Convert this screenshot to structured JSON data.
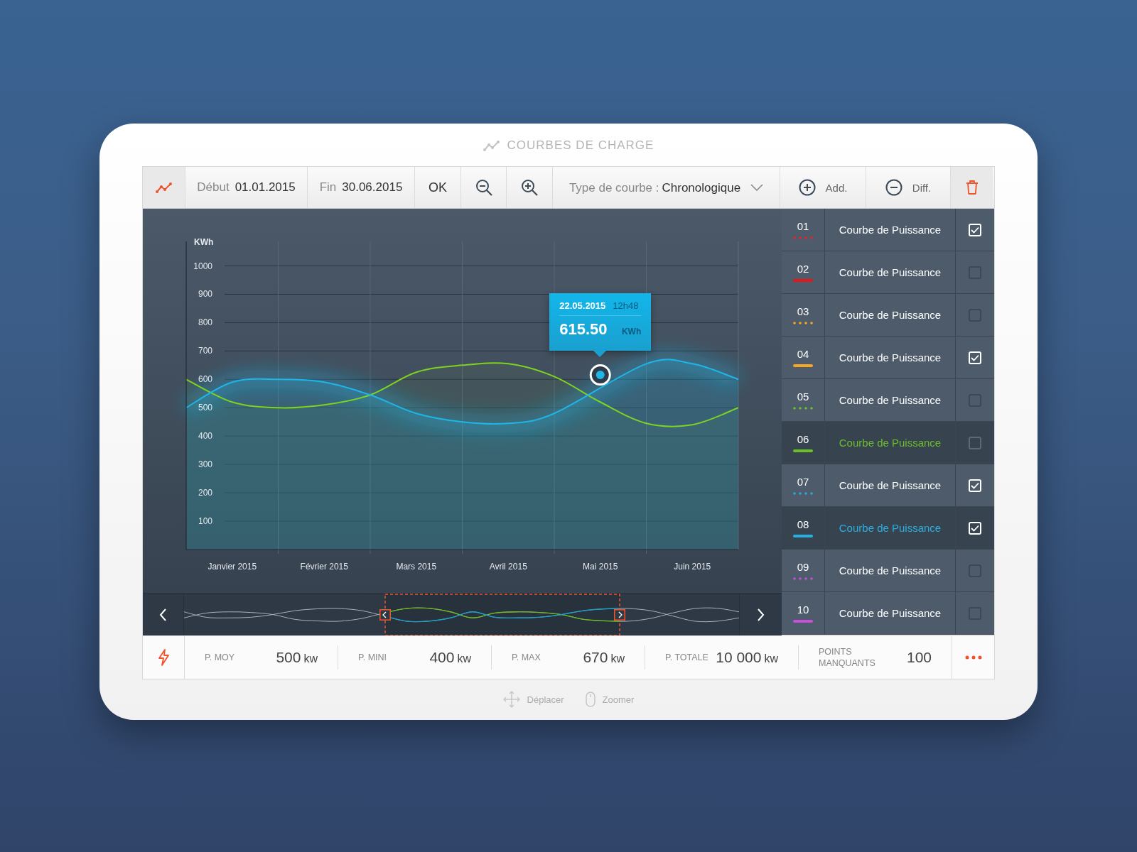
{
  "title": "COURBES DE CHARGE",
  "toolbar": {
    "start": {
      "label": "Début",
      "value": "01.01.2015"
    },
    "end": {
      "label": "Fin",
      "value": "30.06.2015"
    },
    "ok": "OK",
    "curve_type": {
      "label": "Type de courbe :",
      "value": "Chronologique"
    },
    "add": "Add.",
    "diff": "Diff."
  },
  "chart": {
    "tooltip": {
      "date": "22.05.2015",
      "time": "12h48",
      "unit": "KWh"
    },
    "chart_data": {
      "type": "area",
      "ylabel": "KWh",
      "grid": true,
      "categories": [
        null,
        "Janvier 2015",
        null,
        "Février 2015",
        null,
        "Mars 2015",
        null,
        "Avril 2015",
        null,
        "Mai 2015",
        null,
        "Juin 2015",
        null
      ],
      "ylim": [
        0,
        1000
      ],
      "yticks": [
        {
          "value": 100,
          "label": "100"
        },
        {
          "value": 200,
          "label": "200"
        },
        {
          "value": 300,
          "label": "300"
        },
        {
          "value": 400,
          "label": "400"
        },
        {
          "value": 500,
          "label": "500"
        },
        {
          "value": 600,
          "label": "600"
        },
        {
          "value": 700,
          "label": "700"
        },
        {
          "value": 800,
          "label": "800"
        },
        {
          "value": 900,
          "label": "900"
        },
        {
          "value": 1000,
          "label": "1000"
        }
      ],
      "series": [
        {
          "color": "#7ed321",
          "values": [
            600,
            520,
            500,
            510,
            545,
            625,
            650,
            655,
            610,
            520,
            445,
            440,
            500
          ]
        },
        {
          "color": "#1fb5e6",
          "values": [
            500,
            590,
            600,
            590,
            545,
            480,
            450,
            445,
            480,
            null,
            655,
            655,
            600
          ]
        }
      ],
      "annotations": [
        {
          "x": "Mai 2015",
          "y": 615.5,
          "text": "615.50"
        }
      ]
    }
  },
  "legend": [
    {
      "number": "01",
      "kind": "dotted",
      "color": "#e8262a",
      "label": "Courbe de Puissance",
      "checked": true,
      "selected": false
    },
    {
      "number": "02",
      "kind": "solid",
      "color": "#e8141b",
      "label": "Courbe de Puissance",
      "checked": false,
      "selected": false
    },
    {
      "number": "03",
      "kind": "dotted",
      "color": "#f5a623",
      "label": "Courbe de Puissance",
      "checked": false,
      "selected": false
    },
    {
      "number": "04",
      "kind": "solid",
      "color": "#f5a623",
      "label": "Courbe de Puissance",
      "checked": true,
      "selected": false
    },
    {
      "number": "05",
      "kind": "dotted",
      "color": "#6cbf2a",
      "label": "Courbe de Puissance",
      "checked": false,
      "selected": false
    },
    {
      "number": "06",
      "kind": "solid",
      "color": "#6cbf2a",
      "label": "Courbe de Puissance",
      "checked": false,
      "selected": true
    },
    {
      "number": "07",
      "kind": "dotted",
      "color": "#29a9d8",
      "label": "Courbe de Puissance",
      "checked": true,
      "selected": false
    },
    {
      "number": "08",
      "kind": "solid",
      "color": "#29b0e0",
      "label": "Courbe de Puissance",
      "checked": true,
      "selected": true
    },
    {
      "number": "09",
      "kind": "dotted",
      "color": "#c84fd8",
      "label": "Courbe de Puissance",
      "checked": false,
      "selected": false
    },
    {
      "number": "10",
      "kind": "solid",
      "color": "#c84fd8",
      "label": "Courbe de Puissance",
      "checked": false,
      "selected": false
    }
  ],
  "stats": [
    {
      "label": "P. MOY",
      "value": "500",
      "unit": "kw"
    },
    {
      "label": "P. MINI",
      "value": "400",
      "unit": "kw"
    },
    {
      "label": "P. MAX",
      "value": "670",
      "unit": "kw"
    },
    {
      "label": "P. TOTALE",
      "value": "10 000",
      "unit": "kw"
    },
    {
      "label": "POINTS MANQUANTS",
      "value": "100"
    }
  ],
  "hints": [
    {
      "kind": "move",
      "label": "Déplacer"
    },
    {
      "kind": "mouse",
      "label": "Zoomer"
    }
  ]
}
